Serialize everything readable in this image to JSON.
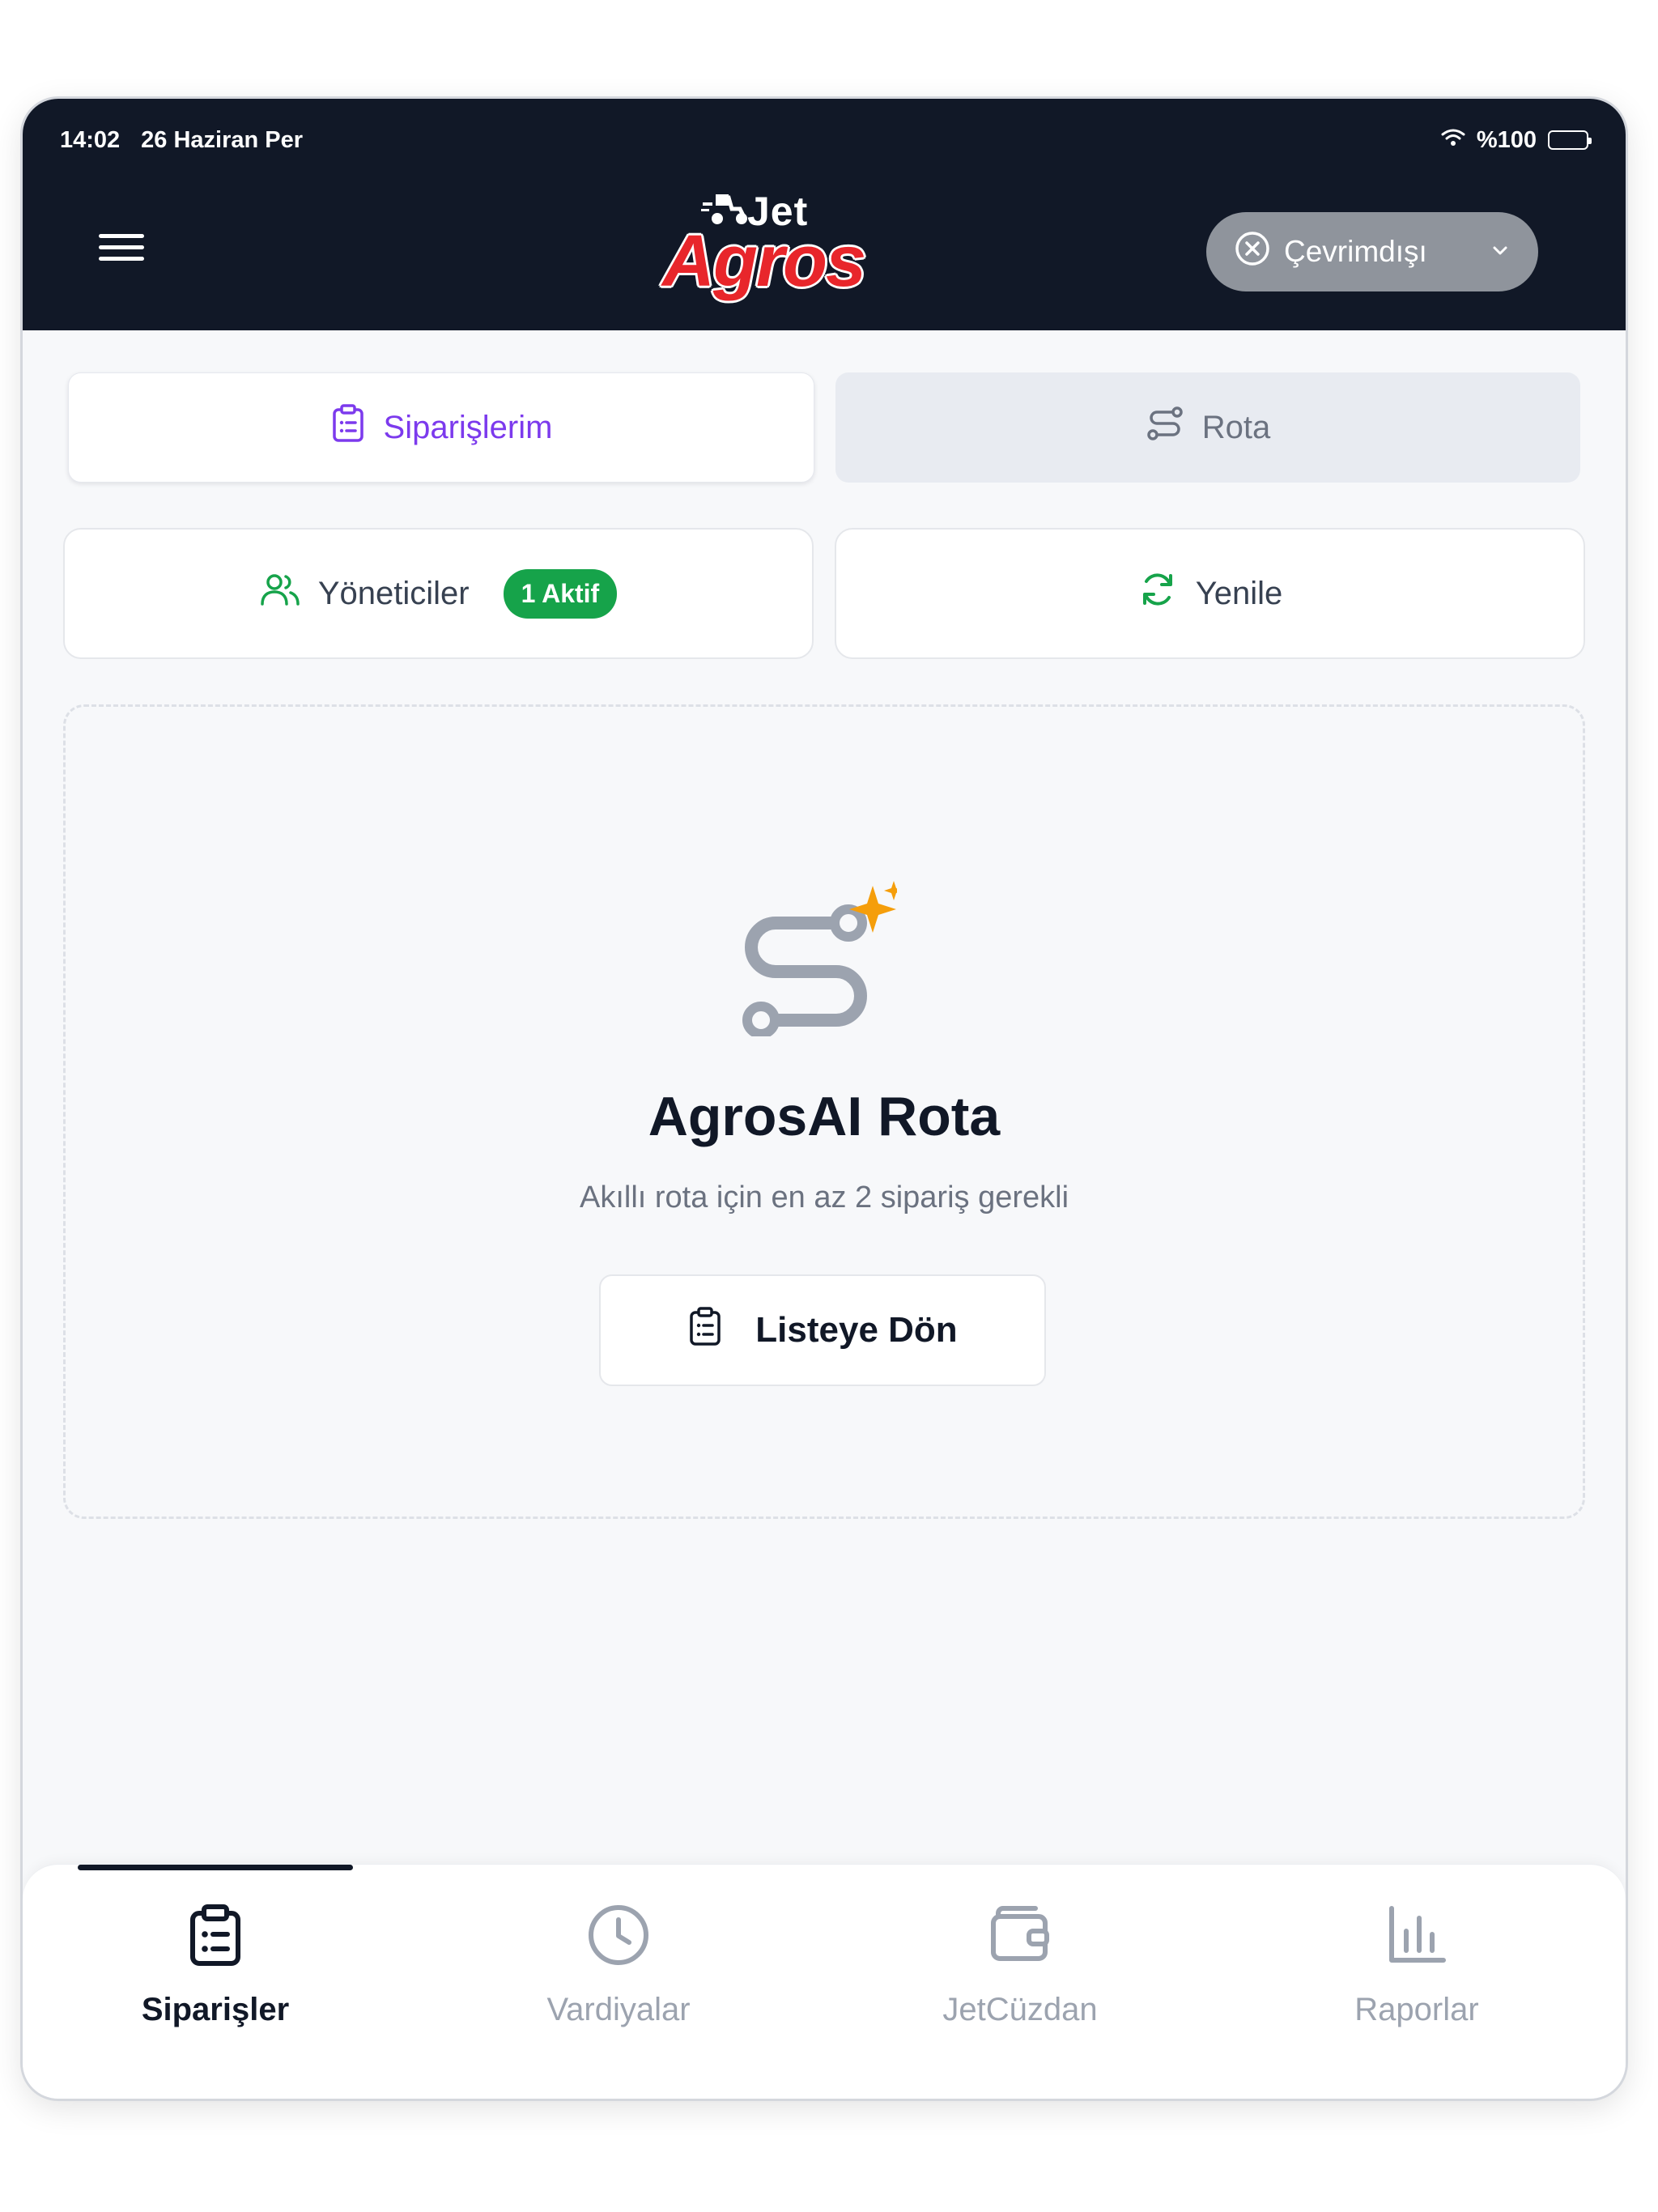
{
  "status_bar": {
    "time": "14:02",
    "date": "26 Haziran Per",
    "battery": "%100"
  },
  "header": {
    "logo_small": "Jet",
    "logo_main": "Agros",
    "connection_status": "Çevrimdışı",
    "colors": {
      "background": "#111827",
      "logo_red": "#e8262b",
      "status_pill": "#8f949c"
    }
  },
  "tabs": [
    {
      "label": "Siparişlerim",
      "icon": "clipboard-list-icon",
      "active": true
    },
    {
      "label": "Rota",
      "icon": "route-icon",
      "active": false
    }
  ],
  "actions": {
    "managers_label": "Yöneticiler",
    "managers_badge": "1 Aktif",
    "refresh_label": "Yenile"
  },
  "empty_state": {
    "icon": "route-sparkle-icon",
    "title": "AgrosAI Rota",
    "subtitle": "Akıllı rota için en az 2 sipariş gerekli",
    "button_label": "Listeye Dön"
  },
  "bottom_nav": [
    {
      "label": "Siparişler",
      "icon": "clipboard-list-icon",
      "active": true
    },
    {
      "label": "Vardiyalar",
      "icon": "clock-icon",
      "active": false
    },
    {
      "label": "JetCüzdan",
      "icon": "wallet-icon",
      "active": false
    },
    {
      "label": "Raporlar",
      "icon": "bar-chart-icon",
      "active": false
    }
  ],
  "theme": {
    "accent": "#7c3aed",
    "success": "#16a34a",
    "muted": "#9ca3af",
    "sparkle": "#f59e0b"
  }
}
